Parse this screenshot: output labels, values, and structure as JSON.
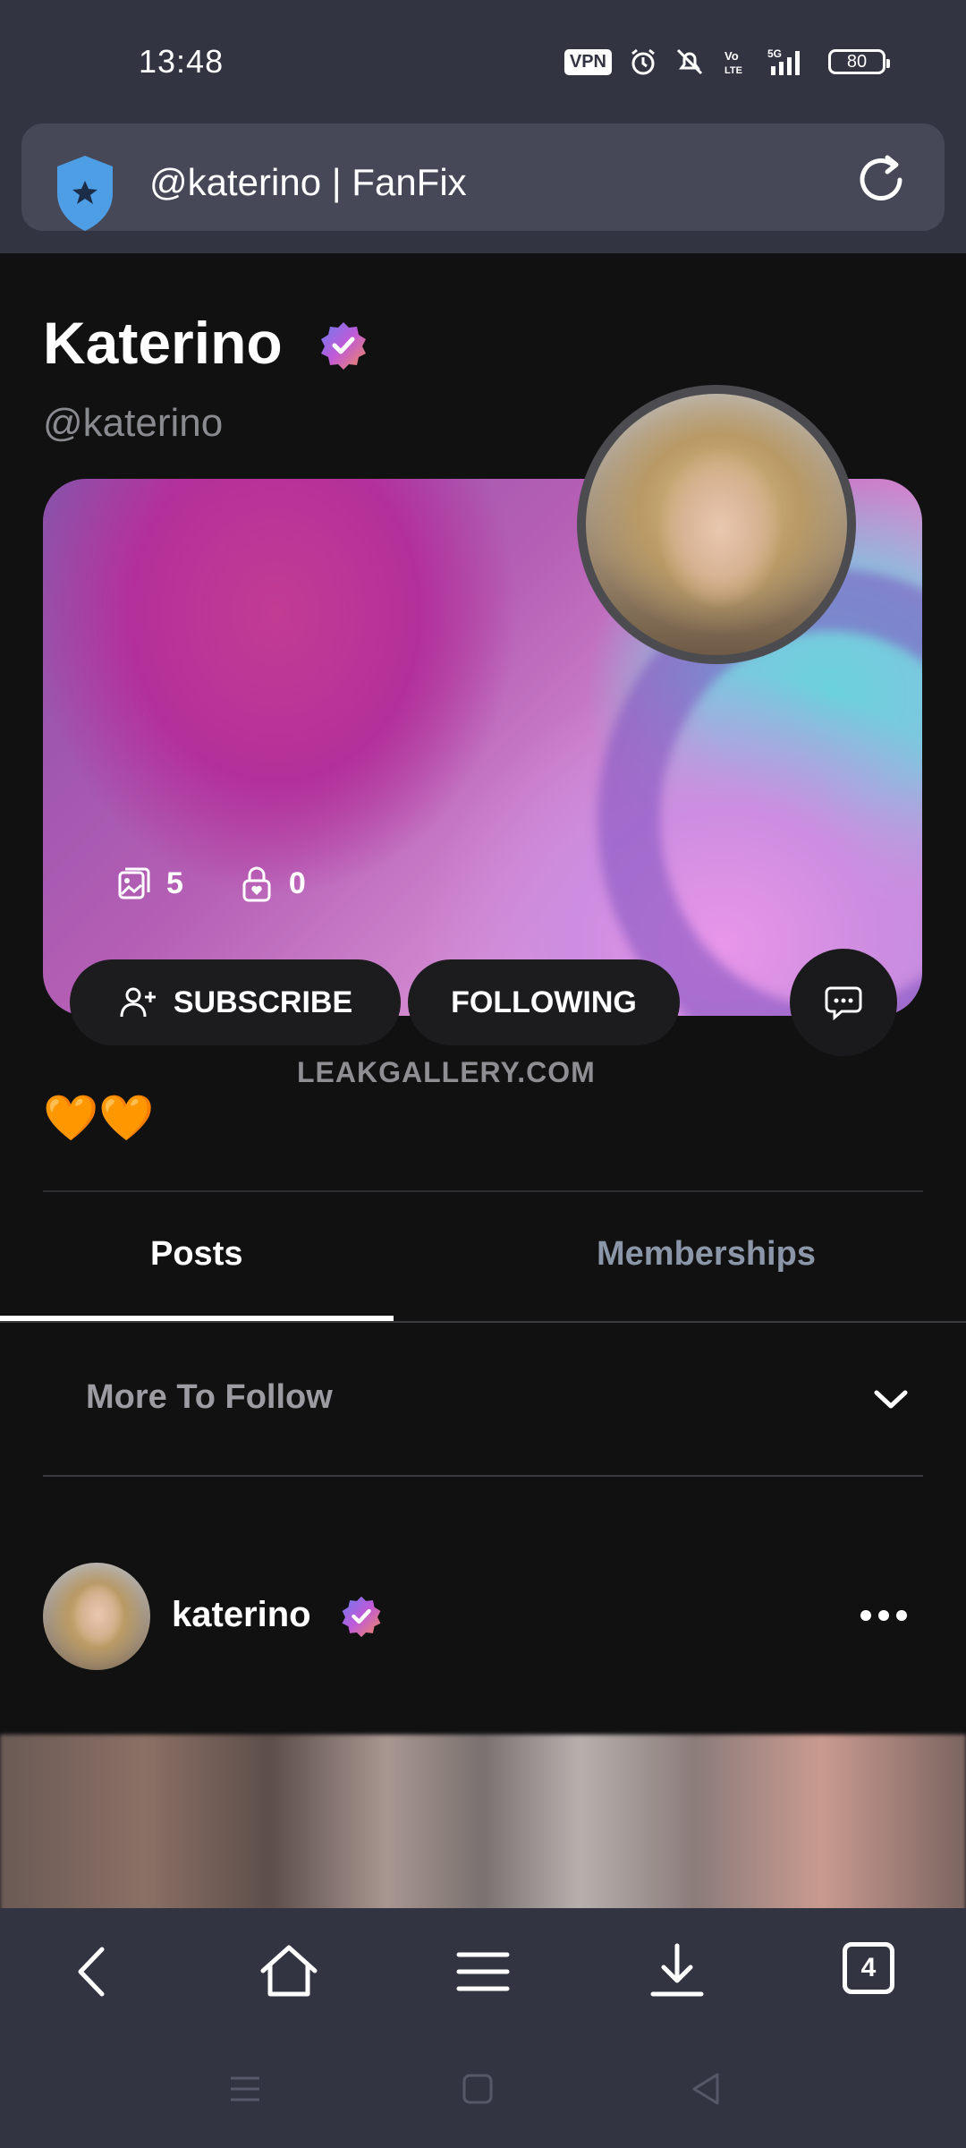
{
  "status_bar": {
    "time": "13:48",
    "vpn": "VPN",
    "network": "5G",
    "battery": "80",
    "icons": [
      "vpn-badge",
      "alarm-icon",
      "mute-icon",
      "volte-icon",
      "signal-icon",
      "battery-icon"
    ]
  },
  "browser": {
    "page_title": "@katerino | FanFix",
    "site_icon": "shield-icon",
    "reload_icon": "refresh-icon"
  },
  "profile": {
    "name": "Katerino",
    "handle": "@katerino",
    "media_count": "5",
    "locked_count": "0",
    "bio": "🧡🧡",
    "watermark": "LEAKGALLERY.COM"
  },
  "actions": {
    "subscribe": "SUBSCRIBE",
    "following": "FOLLOWING"
  },
  "tabs": [
    {
      "label": "Posts",
      "active": true
    },
    {
      "label": "Memberships",
      "active": false
    }
  ],
  "more_to_follow": "More To Follow",
  "post": {
    "username": "katerino"
  },
  "bottom_nav": {
    "tab_count": "4",
    "items": [
      "back-icon",
      "home-icon",
      "menu-icon",
      "download-icon",
      "tabs-icon"
    ]
  },
  "colors": {
    "background": "#111112",
    "chrome": "#333442",
    "urlbar": "#464857",
    "shield": "#4e9ee6",
    "inactive_tab": "#8b96a8"
  }
}
